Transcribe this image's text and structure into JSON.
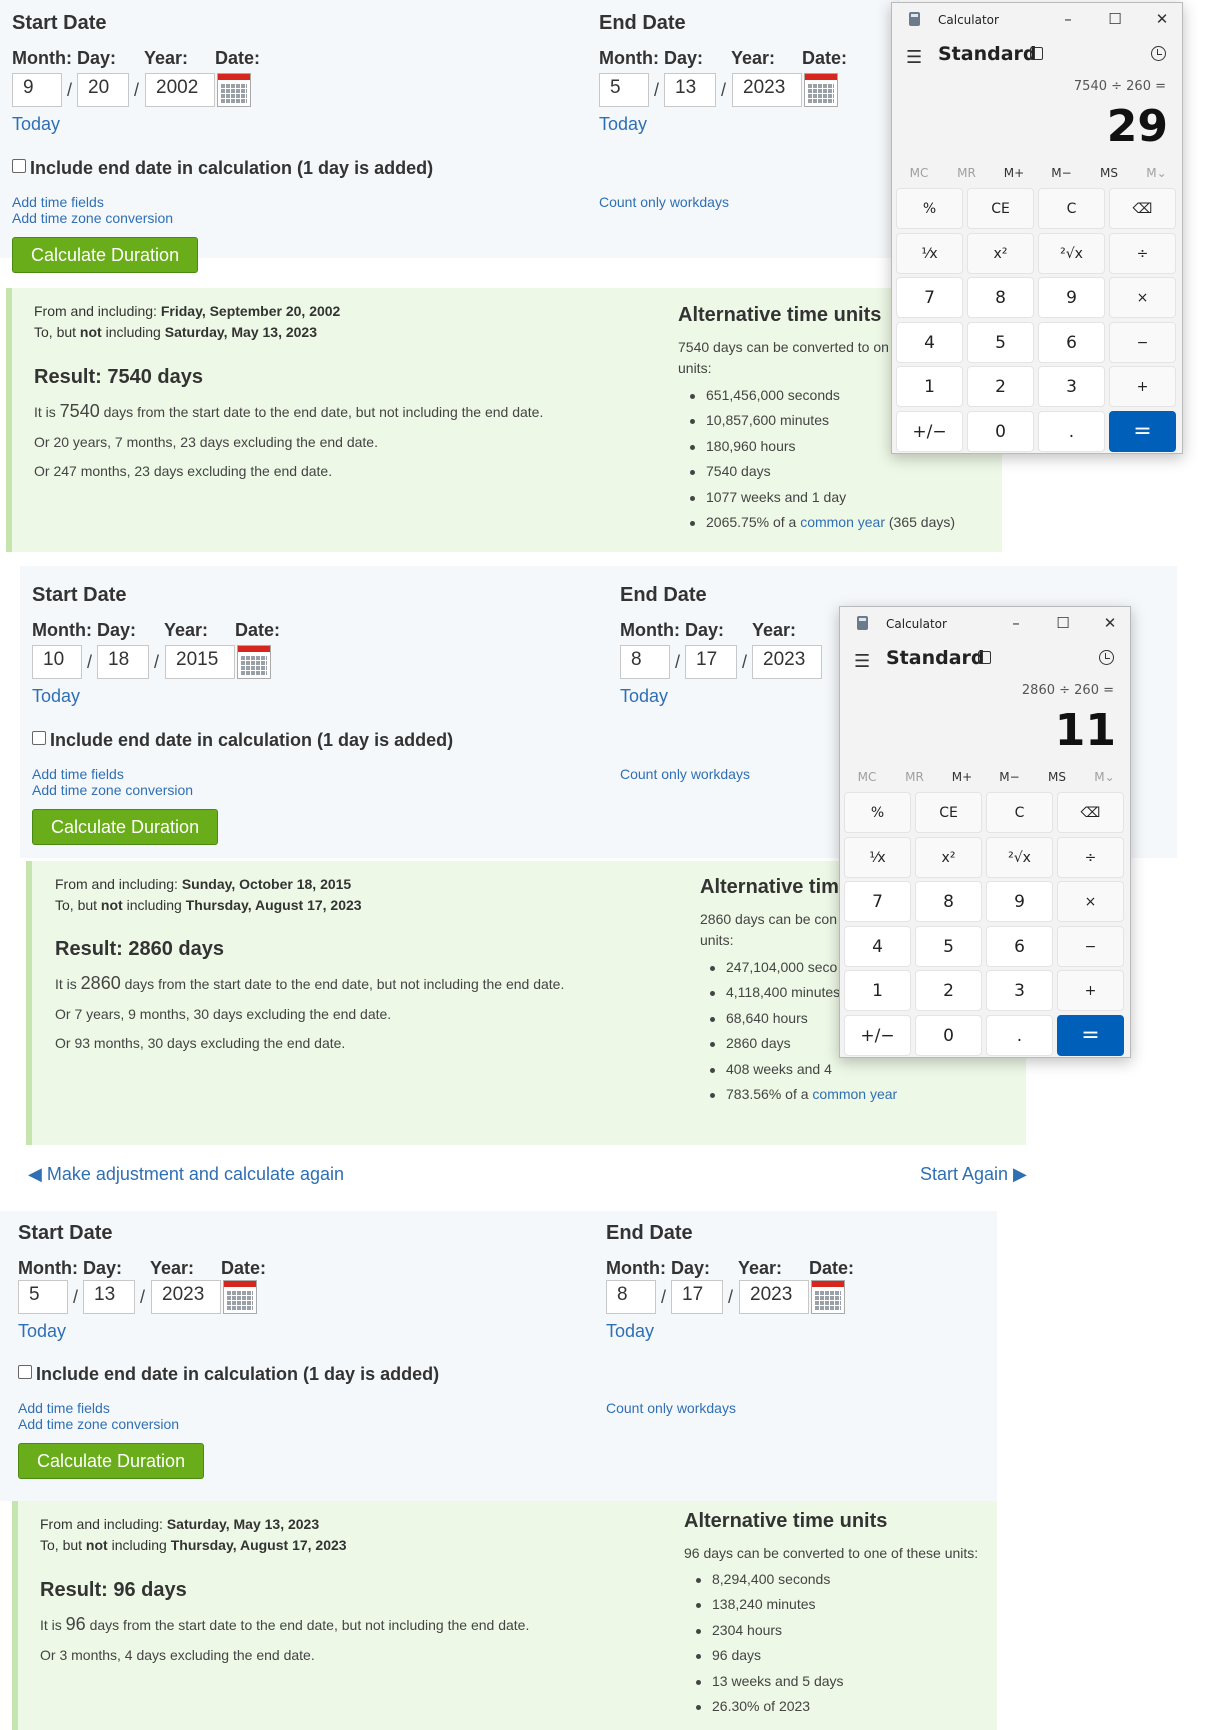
{
  "labels": {
    "start_date": "Start Date",
    "end_date": "End Date",
    "month_day": "Month: Day:",
    "year": "Year:",
    "date": "Date:",
    "today": "Today",
    "include_end": "Include end date in calculation (1 day is added)",
    "add_time_fields": "Add time fields",
    "add_time_zone": "Add time zone conversion",
    "count_workdays": "Count only workdays",
    "calculate": "Calculate Duration",
    "alt_title": "Alternative time units",
    "slash": "/",
    "from_prefix": "From and including: ",
    "to_prefix": "To, but ",
    "to_not": "not",
    "to_suffix": " including "
  },
  "sections": [
    {
      "start": {
        "month": "9",
        "day": "20",
        "year": "2002"
      },
      "end": {
        "month": "5",
        "day": "13",
        "year": "2023"
      },
      "from_date": "Friday, September 20, 2002",
      "to_date": "Saturday, May 13, 2023",
      "result": "Result: 7540 days",
      "line1_pre": "It is ",
      "line1_num": "7540",
      "line1_post": " days from the start date to the end date, but not including the end date.",
      "line2": "Or 20 years, 7 months, 23 days excluding the end date.",
      "line3": "Or 247 months, 23 days excluding the end date.",
      "alt_intro": "7540 days can be converted to one of these units:",
      "alt_intro_a": "7540 days can be converted to on",
      "alt_intro_b": "units:",
      "alt_items": [
        "651,456,000 seconds",
        "10,857,600 minutes",
        "180,960 hours",
        "7540 days",
        "1077 weeks and 1 day"
      ],
      "alt_last_pre": "2065.75% of a ",
      "alt_last_link": "common year",
      "alt_last_post": " (365 days)"
    },
    {
      "start": {
        "month": "10",
        "day": "18",
        "year": "2015"
      },
      "end": {
        "month": "8",
        "day": "17",
        "year": "2023"
      },
      "from_date": "Sunday, October 18, 2015",
      "to_date": "Thursday, August 17, 2023",
      "result": "Result: 2860 days",
      "line1_pre": "It is ",
      "line1_num": "2860",
      "line1_post": " days from the start date to the end date, but not including the end date.",
      "line2": "Or 7 years, 9 months, 30 days excluding the end date.",
      "line3": "Or 93 months, 30 days excluding the end date.",
      "alt_title_partial": "Alternative tim",
      "alt_intro_a": "2860 days can be con",
      "alt_intro_b": "units:",
      "alt_items": [
        "247,104,000 seco",
        "4,118,400 minutes",
        "68,640 hours",
        "2860 days",
        "408 weeks and 4"
      ],
      "alt_last_pre": "783.56% of a ",
      "alt_last_link": "common year"
    },
    {
      "start": {
        "month": "5",
        "day": "13",
        "year": "2023"
      },
      "end": {
        "month": "8",
        "day": "17",
        "year": "2023"
      },
      "from_date": "Saturday, May 13, 2023",
      "to_date": "Thursday, August 17, 2023",
      "result": "Result: 96 days",
      "line1_pre": "It is ",
      "line1_num": "96",
      "line1_post": " days from the start date to the end date, but not including the end date.",
      "line2": "Or 3 months, 4 days excluding the end date.",
      "alt_intro": "96 days can be converted to one of these units:",
      "alt_items": [
        "8,294,400 seconds",
        "138,240 minutes",
        "2304 hours",
        "96 days",
        "13 weeks and 5 days",
        "26.30% of 2023"
      ]
    }
  ],
  "nav": {
    "adjust": "◀ Make adjustment and calculate again",
    "start_again": "Start Again ▶"
  },
  "calculators": [
    {
      "title": "Calculator",
      "mode": "Standard",
      "expression": "7540 ÷ 260 =",
      "display": "29"
    },
    {
      "title": "Calculator",
      "mode": "Standard",
      "expression": "2860 ÷ 260 =",
      "display": "11"
    }
  ],
  "calc_keys": {
    "memory": [
      "MC",
      "MR",
      "M+",
      "M−",
      "MS",
      "M⌄"
    ],
    "rows": [
      [
        "%",
        "CE",
        "C",
        "⌫"
      ],
      [
        "¹⁄x",
        "x²",
        "²√x",
        "÷"
      ],
      [
        "7",
        "8",
        "9",
        "×"
      ],
      [
        "4",
        "5",
        "6",
        "−"
      ],
      [
        "1",
        "2",
        "3",
        "+"
      ],
      [
        "+/−",
        "0",
        ".",
        "="
      ]
    ]
  },
  "colors": {
    "accent_green": "#6aad1a",
    "link_blue": "#2f6fb3",
    "equals_blue": "#005fb8",
    "result_bg": "#eef8e6"
  }
}
